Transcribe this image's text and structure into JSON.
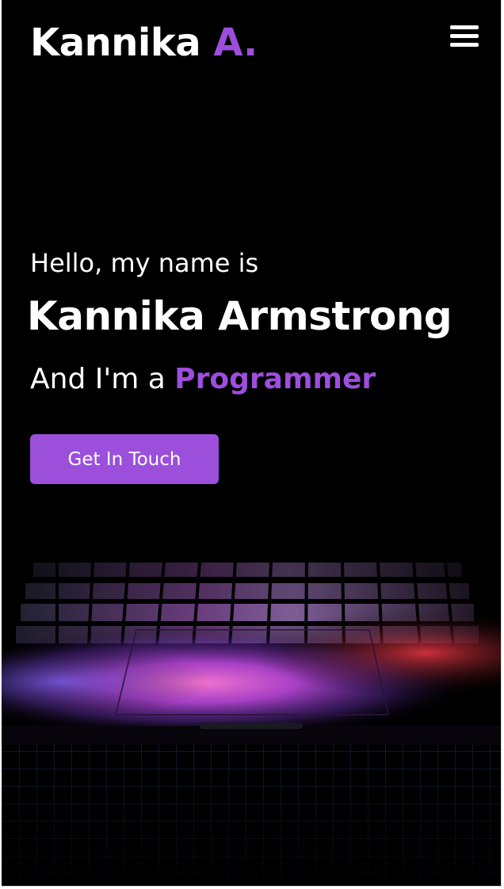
{
  "header": {
    "logo_first": "Kannika",
    "logo_accent": "A."
  },
  "hero": {
    "greeting": "Hello, my name is",
    "name": "Kannika Armstrong",
    "role_prefix": "And I'm a",
    "role": "Programmer",
    "cta_label": "Get In Touch"
  },
  "colors": {
    "accent": "#9d4edd",
    "background": "#000000",
    "text": "#ffffff"
  },
  "icons": {
    "menu": "hamburger-menu-icon"
  }
}
